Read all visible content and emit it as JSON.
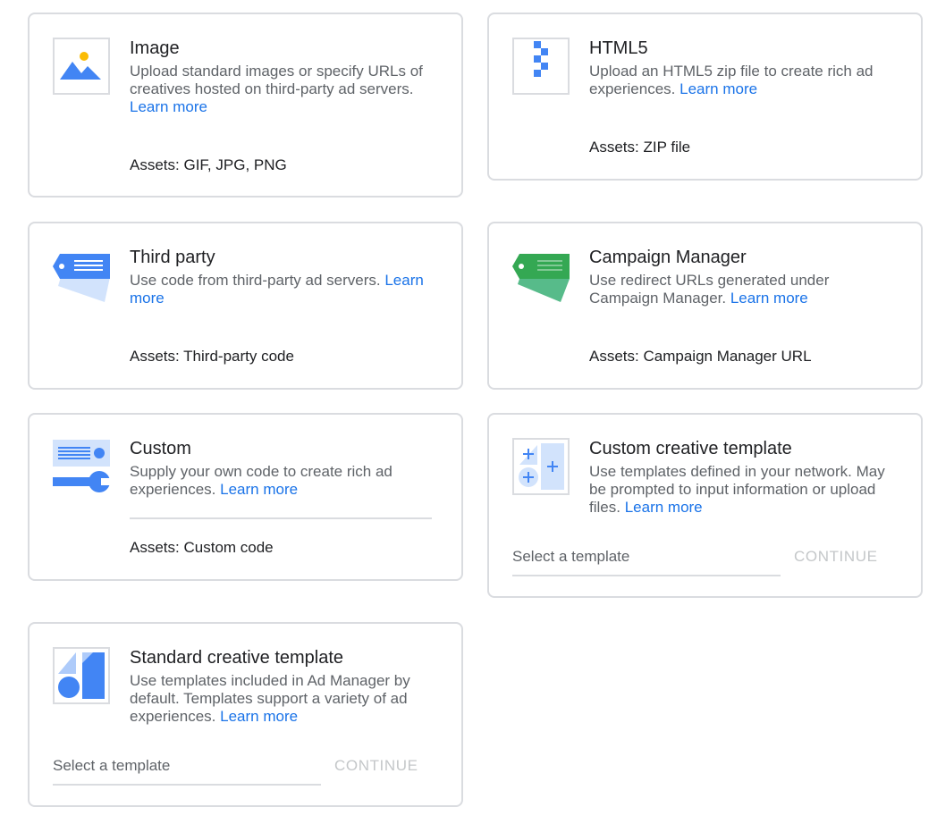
{
  "learn_more": "Learn more",
  "cards": {
    "image": {
      "title": "Image",
      "desc": "Upload standard images or specify URLs of creatives hosted on third-party ad servers.",
      "assets_label": "Assets:",
      "assets_value": "GIF, JPG, PNG",
      "icon": "image-icon"
    },
    "html5": {
      "title": "HTML5",
      "desc": "Upload an HTML5 zip file to create rich ad experiences.",
      "assets_label": "Assets:",
      "assets_value": "ZIP file",
      "icon": "zip-file-icon"
    },
    "third_party": {
      "title": "Third party",
      "desc": "Use code from third-party ad servers.",
      "assets_label": "Assets:",
      "assets_value": "Third-party code",
      "icon": "tag-icon"
    },
    "campaign_manager": {
      "title": "Campaign Manager",
      "desc": "Use redirect URLs generated under Campaign Manager.",
      "assets_label": "Assets:",
      "assets_value": "Campaign Manager URL",
      "icon": "green-tag-icon"
    },
    "custom": {
      "title": "Custom",
      "desc": "Supply your own code to create rich ad experiences.",
      "assets_label": "Assets:",
      "assets_value": "Custom code",
      "icon": "wrench-icon"
    },
    "custom_template": {
      "title": "Custom creative template",
      "desc": "Use templates defined in your network. May be prompted to input information or upload files.",
      "select_placeholder": "Select a template",
      "continue_label": "CONTINUE",
      "icon": "custom-template-icon"
    },
    "standard_template": {
      "title": "Standard creative template",
      "desc": "Use templates included in Ad Manager by default. Templates support a variety of ad experiences.",
      "select_placeholder": "Select a template",
      "continue_label": "CONTINUE",
      "icon": "shapes-icon"
    }
  },
  "colors": {
    "link": "#1a73e8",
    "border": "#dadce0",
    "blue": "#4285f4",
    "light_blue": "#d2e3fc",
    "green": "#34a853",
    "yellow": "#fbbc04",
    "disabled": "#c4c7c9"
  }
}
